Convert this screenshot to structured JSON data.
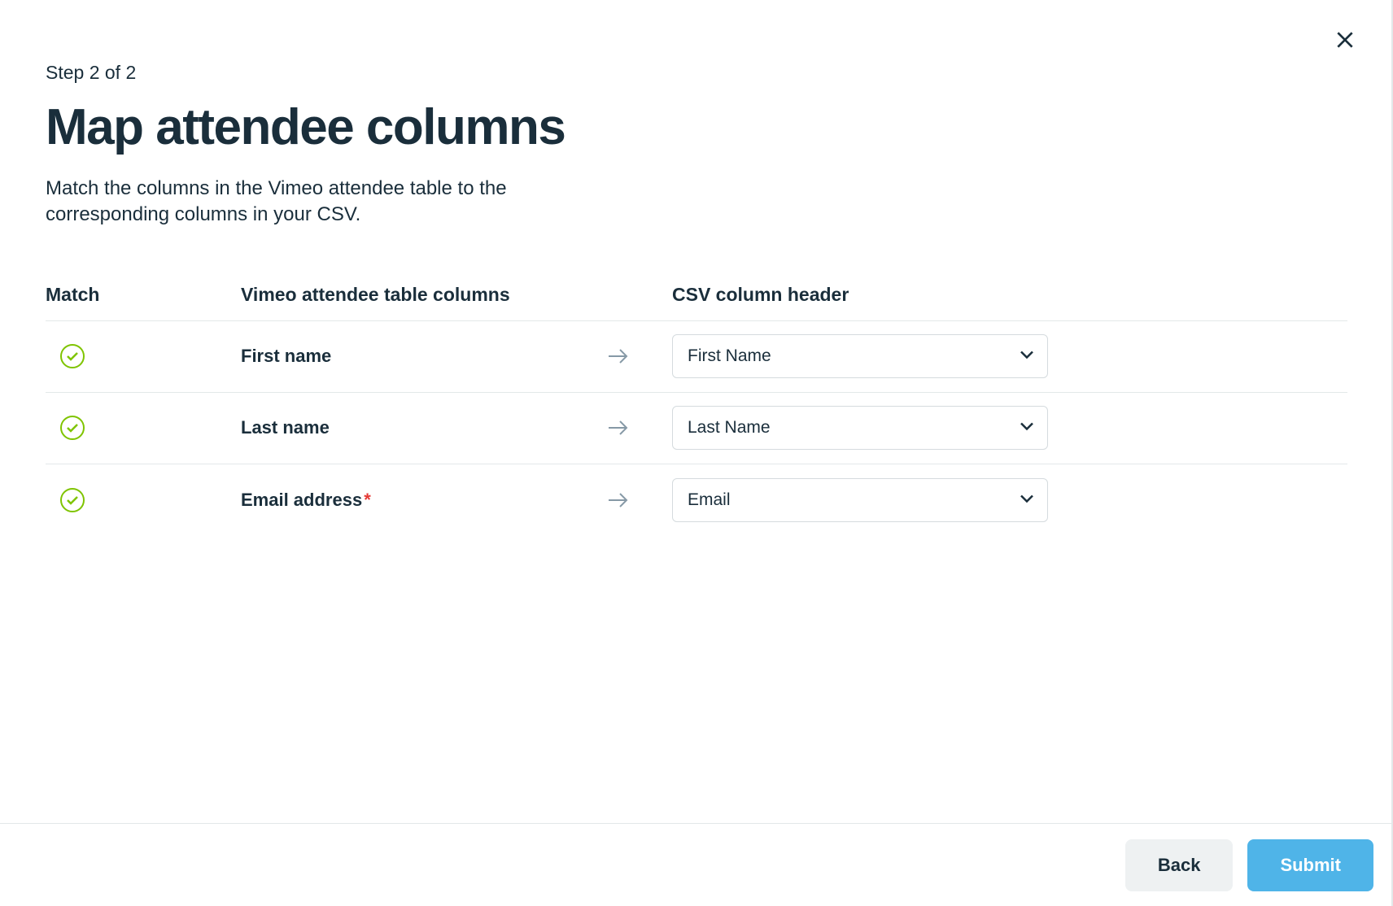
{
  "step_label": "Step 2 of 2",
  "title": "Map attendee columns",
  "description": "Match the columns in the Vimeo attendee table to the corresponding columns in your CSV.",
  "table": {
    "header": {
      "match": "Match",
      "vimeo": "Vimeo attendee table columns",
      "csv": "CSV column header"
    },
    "rows": [
      {
        "matched": true,
        "vimeo_label": "First name",
        "required": false,
        "csv_value": "First Name"
      },
      {
        "matched": true,
        "vimeo_label": "Last name",
        "required": false,
        "csv_value": "Last Name"
      },
      {
        "matched": true,
        "vimeo_label": "Email address",
        "required": true,
        "csv_value": "Email"
      }
    ]
  },
  "footer": {
    "back_label": "Back",
    "submit_label": "Submit"
  }
}
